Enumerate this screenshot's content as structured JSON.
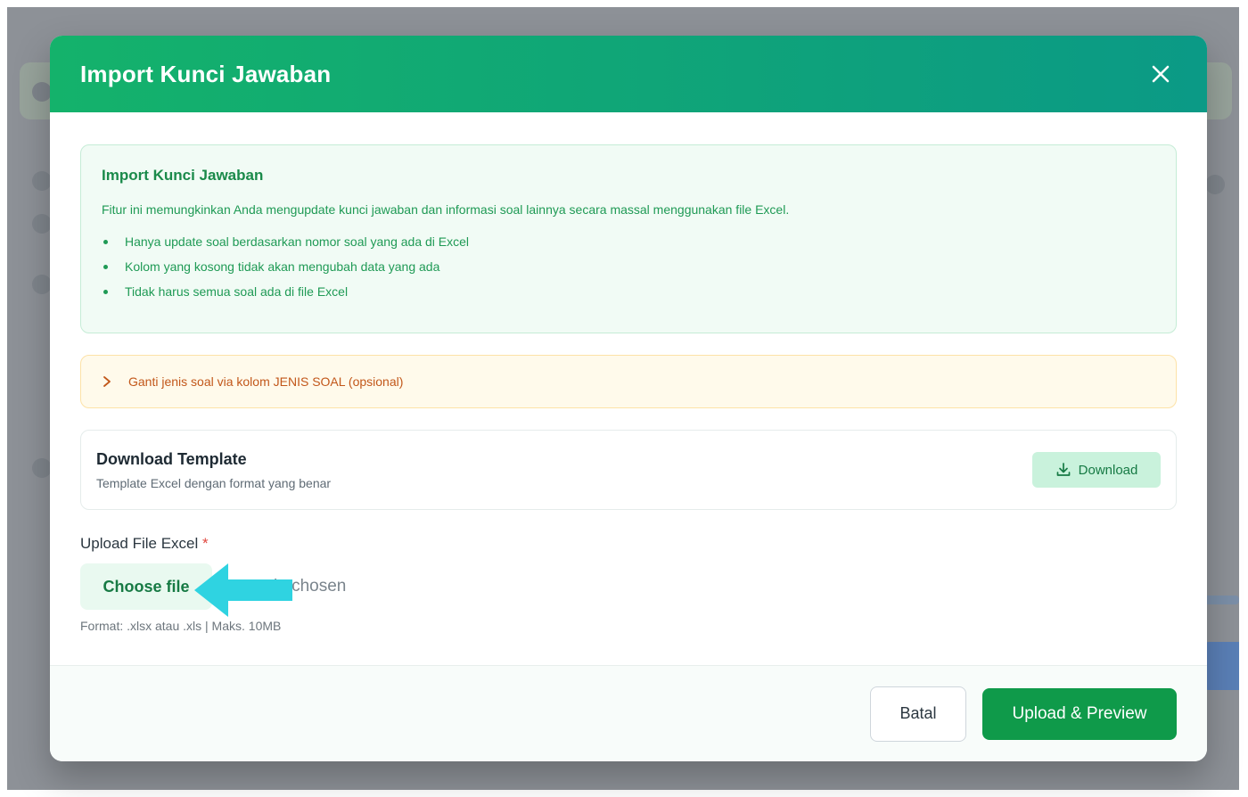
{
  "colors": {
    "header_start": "#14b26b",
    "header_end": "#0b9a86",
    "primary": "#0f9a4a",
    "info_text": "#1f9a55",
    "warn_text": "#c2571a",
    "required": "#e0483f",
    "arrow": "#2fd3e1"
  },
  "modal": {
    "title": "Import Kunci Jawaban",
    "close_icon": "close-icon"
  },
  "info": {
    "title": "Import Kunci Jawaban",
    "description": "Fitur ini memungkinkan Anda mengupdate kunci jawaban dan informasi soal lainnya secara massal menggunakan file Excel.",
    "items": [
      "Hanya update soal berdasarkan nomor soal yang ada di Excel",
      "Kolom yang kosong tidak akan mengubah data yang ada",
      "Tidak harus semua soal ada di file Excel"
    ]
  },
  "warning": {
    "icon": "chevron-right-icon",
    "text": "Ganti jenis soal via kolom JENIS SOAL (opsional)"
  },
  "template": {
    "title": "Download Template",
    "description": "Template Excel dengan format yang benar",
    "download_icon": "download-icon",
    "download_label": "Download"
  },
  "upload": {
    "label": "Upload File Excel",
    "required_mark": "*",
    "choose_label": "Choose file",
    "status_visible": "le chosen",
    "format_hint": "Format: .xlsx atau .xls | Maks. 10MB"
  },
  "footer": {
    "cancel_label": "Batal",
    "submit_label": "Upload & Preview"
  }
}
